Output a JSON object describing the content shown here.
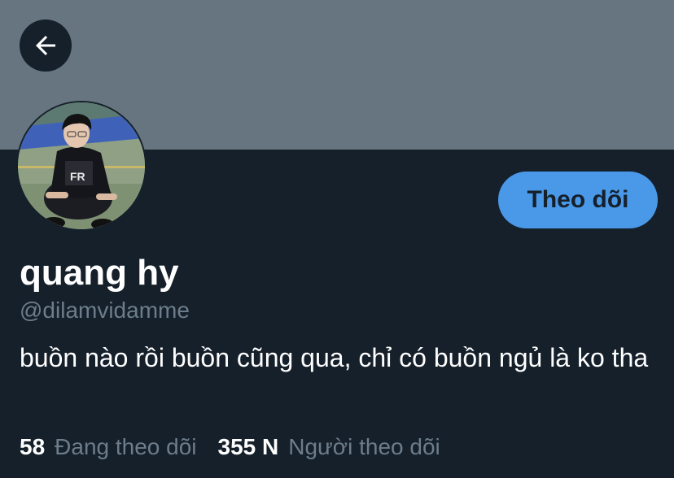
{
  "profile": {
    "display_name": "quang hy",
    "handle": "@dilamvidamme",
    "bio": "buồn nào rồi buồn cũng qua, chỉ có buồn ngủ là ko tha"
  },
  "actions": {
    "follow_label": "Theo dõi",
    "back_icon": "arrow-left-icon"
  },
  "stats": {
    "following_count": "58",
    "following_label": "Đang theo dõi",
    "followers_count": "355 N",
    "followers_label": "Người theo dõi"
  },
  "colors": {
    "background": "#15202b",
    "banner": "#66757f",
    "accent": "#4a99e9",
    "secondary_text": "#6e7d8b"
  }
}
